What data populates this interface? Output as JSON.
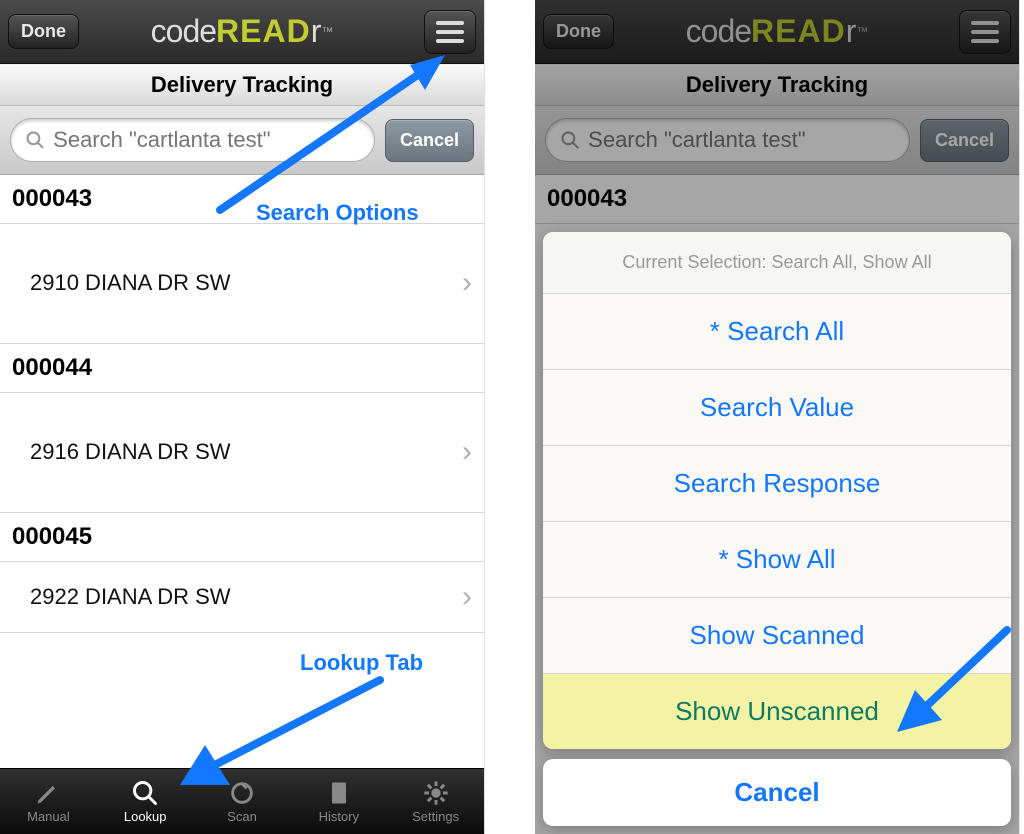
{
  "brand": {
    "part1": "code",
    "part2": "READ",
    "part3": "r",
    "tm": "™"
  },
  "section_title": "Delivery Tracking",
  "done_label": "Done",
  "search": {
    "placeholder": "Search \"cartlanta test\""
  },
  "cancel_label": "Cancel",
  "records": [
    {
      "id": "000043",
      "address": "2910 DIANA DR SW"
    },
    {
      "id": "000044",
      "address": "2916 DIANA DR SW"
    },
    {
      "id": "000045",
      "address": "2922 DIANA DR SW"
    }
  ],
  "tabs": {
    "manual": "Manual",
    "lookup": "Lookup",
    "scan": "Scan",
    "history": "History",
    "settings": "Settings"
  },
  "annotations": {
    "search_options": "Search Options",
    "lookup_tab": "Lookup Tab"
  },
  "sheet": {
    "head": "Current Selection: Search All, Show All",
    "items": [
      {
        "label": "* Search All",
        "highlight": false
      },
      {
        "label": "Search Value",
        "highlight": false
      },
      {
        "label": "Search Response",
        "highlight": false
      },
      {
        "label": "* Show All",
        "highlight": false
      },
      {
        "label": "Show Scanned",
        "highlight": false
      },
      {
        "label": "Show Unscanned",
        "highlight": true
      }
    ],
    "cancel": "Cancel"
  }
}
